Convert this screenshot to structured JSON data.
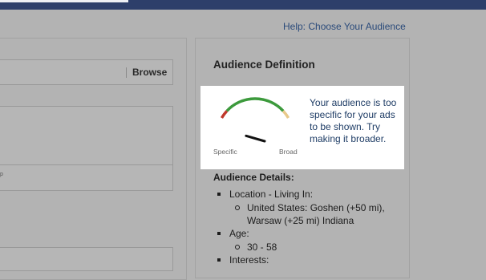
{
  "help": {
    "link": "Help: Choose Your Audience"
  },
  "left": {
    "browse_label": "Browse",
    "field_tick": "p"
  },
  "definition": {
    "title": "Audience Definition",
    "gauge": {
      "left_label": "Specific",
      "right_label": "Broad",
      "level": 0.08,
      "colors": {
        "specific": "#c0392b",
        "mid": "#3c9a3c",
        "broad": "#e8c98a",
        "needle": "#111111"
      }
    },
    "message": "Your audience is too specific for your ads to be shown. Try making it broader."
  },
  "details": {
    "title": "Audience Details:",
    "items": [
      {
        "label": "Location - Living In:",
        "subitems": [
          "United States: Goshen (+50 mi), Warsaw (+25 mi) Indiana"
        ]
      },
      {
        "label": "Age:",
        "subitems": [
          "30 - 58"
        ]
      },
      {
        "label": "Interests:",
        "subitems": []
      }
    ]
  }
}
